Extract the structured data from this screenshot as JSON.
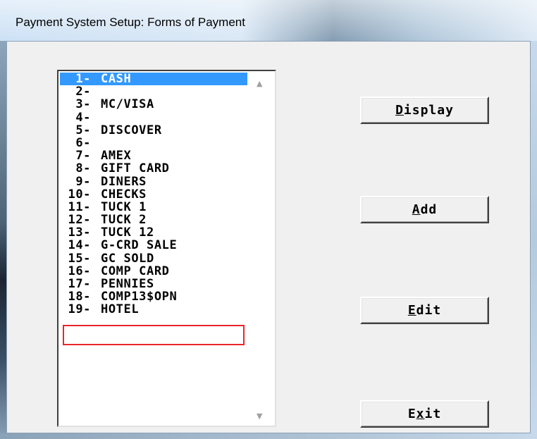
{
  "window": {
    "title": "Payment System Setup:  Forms of Payment"
  },
  "list": {
    "items": [
      {
        "num": "1-",
        "name": "CASH",
        "selected": true
      },
      {
        "num": "2-",
        "name": ""
      },
      {
        "num": "3-",
        "name": "MC/VISA"
      },
      {
        "num": "4-",
        "name": ""
      },
      {
        "num": "5-",
        "name": "DISCOVER"
      },
      {
        "num": "6-",
        "name": ""
      },
      {
        "num": "7-",
        "name": "AMEX"
      },
      {
        "num": "8-",
        "name": "GIFT CARD"
      },
      {
        "num": "9-",
        "name": "DINERS"
      },
      {
        "num": "10-",
        "name": "CHECKS"
      },
      {
        "num": "11-",
        "name": "TUCK 1"
      },
      {
        "num": "12-",
        "name": "TUCK 2"
      },
      {
        "num": "13-",
        "name": "TUCK 12"
      },
      {
        "num": "14-",
        "name": "G-CRD SALE"
      },
      {
        "num": "15-",
        "name": "GC SOLD"
      },
      {
        "num": "16-",
        "name": "COMP CARD"
      },
      {
        "num": "17-",
        "name": "PENNIES",
        "highlighted": true
      },
      {
        "num": "18-",
        "name": "COMP13$OPN"
      },
      {
        "num": "19-",
        "name": "HOTEL"
      }
    ]
  },
  "buttons": {
    "display": {
      "mnemonic": "D",
      "rest": "isplay"
    },
    "add": {
      "mnemonic": "A",
      "rest": "dd"
    },
    "edit": {
      "mnemonic": "E",
      "rest": "dit"
    },
    "exit": {
      "pre": "E",
      "mnemonic": "x",
      "rest": "it"
    }
  },
  "colors": {
    "selection": "#3399ff",
    "highlight_box": "#e8262a"
  },
  "icons": {
    "scroll_up": "scroll-up-arrow-icon",
    "scroll_down": "scroll-down-arrow-icon"
  }
}
